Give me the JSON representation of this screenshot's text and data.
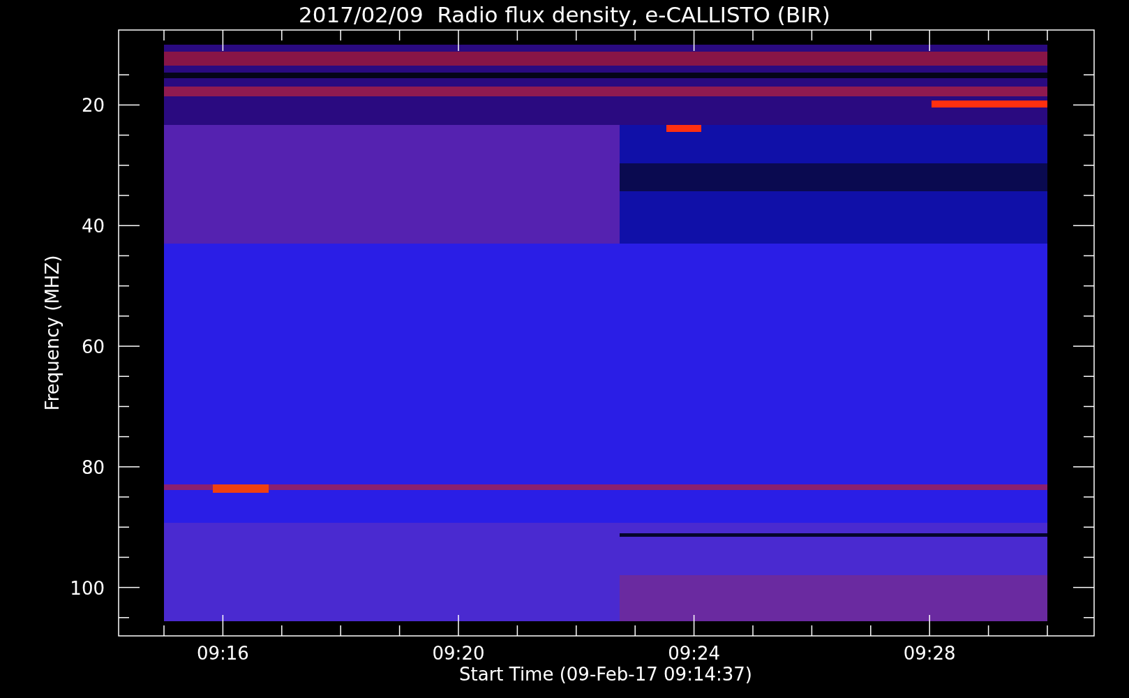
{
  "title": "2017/02/09  Radio flux density, e-CALLISTO (BIR)",
  "y_axis": {
    "label": "Frequency (MHZ)",
    "ticks": [
      "20",
      "40",
      "60",
      "80",
      "100"
    ]
  },
  "x_axis": {
    "label": "Start Time (09-Feb-17 09:14:37)",
    "ticks": [
      "09:16",
      "09:20",
      "09:24",
      "09:28"
    ]
  }
}
